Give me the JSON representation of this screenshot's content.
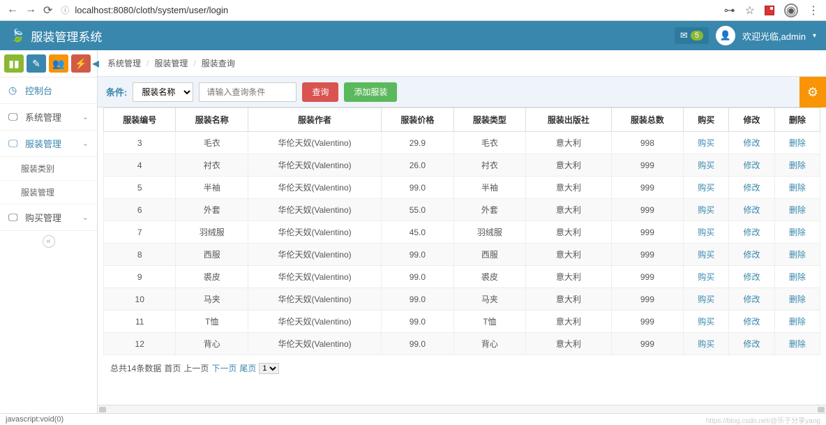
{
  "browser": {
    "url": "localhost:8080/cloth/system/user/login"
  },
  "header": {
    "title": "服装管理系统",
    "mail_badge": "5",
    "welcome": "欢迎光临,admin"
  },
  "sidebar": {
    "items": [
      {
        "label": "控制台",
        "icon": "dashboard"
      },
      {
        "label": "系统管理",
        "icon": "monitor",
        "expandable": true
      },
      {
        "label": "服装管理",
        "icon": "monitor",
        "expandable": true,
        "active": true
      },
      {
        "label": "购买管理",
        "icon": "monitor",
        "expandable": true
      }
    ],
    "sub_items": [
      {
        "label": "服装类别"
      },
      {
        "label": "服装管理"
      }
    ]
  },
  "breadcrumb": {
    "items": [
      "系统管理",
      "服装管理",
      "服装查询"
    ]
  },
  "filter": {
    "label": "条件:",
    "select_value": "服装名称",
    "input_placeholder": "请输入查询条件",
    "search_btn": "查询",
    "add_btn": "添加服装"
  },
  "table": {
    "headers": [
      "服装编号",
      "服装名称",
      "服装作者",
      "服装价格",
      "服装类型",
      "服装出版社",
      "服装总数",
      "购买",
      "修改",
      "删除"
    ],
    "action_buy": "购买",
    "action_edit": "修改",
    "action_delete": "删除",
    "rows": [
      {
        "id": "3",
        "name": "毛衣",
        "author": "华伦天奴(Valentino)",
        "price": "29.9",
        "type": "毛衣",
        "publisher": "意大利",
        "total": "998"
      },
      {
        "id": "4",
        "name": "衬衣",
        "author": "华伦天奴(Valentino)",
        "price": "26.0",
        "type": "衬衣",
        "publisher": "意大利",
        "total": "999"
      },
      {
        "id": "5",
        "name": "半袖",
        "author": "华伦天奴(Valentino)",
        "price": "99.0",
        "type": "半袖",
        "publisher": "意大利",
        "total": "999"
      },
      {
        "id": "6",
        "name": "外套",
        "author": "华伦天奴(Valentino)",
        "price": "55.0",
        "type": "外套",
        "publisher": "意大利",
        "total": "999"
      },
      {
        "id": "7",
        "name": "羽绒服",
        "author": "华伦天奴(Valentino)",
        "price": "45.0",
        "type": "羽绒服",
        "publisher": "意大利",
        "total": "999"
      },
      {
        "id": "8",
        "name": "西服",
        "author": "华伦天奴(Valentino)",
        "price": "99.0",
        "type": "西服",
        "publisher": "意大利",
        "total": "999"
      },
      {
        "id": "9",
        "name": "裘皮",
        "author": "华伦天奴(Valentino)",
        "price": "99.0",
        "type": "裘皮",
        "publisher": "意大利",
        "total": "999"
      },
      {
        "id": "10",
        "name": "马夹",
        "author": "华伦天奴(Valentino)",
        "price": "99.0",
        "type": "马夹",
        "publisher": "意大利",
        "total": "999"
      },
      {
        "id": "11",
        "name": "T恤",
        "author": "华伦天奴(Valentino)",
        "price": "99.0",
        "type": "T恤",
        "publisher": "意大利",
        "total": "999"
      },
      {
        "id": "12",
        "name": "背心",
        "author": "华伦天奴(Valentino)",
        "price": "99.0",
        "type": "背心",
        "publisher": "意大利",
        "total": "999"
      }
    ]
  },
  "pagination": {
    "total_text": "总共14条数据",
    "first": "首页",
    "prev": "上一页",
    "next": "下一页",
    "last": "尾页",
    "page_select": "1"
  },
  "status": {
    "text": "javascript:void(0)",
    "watermark": "https://blog.csdn.net/@乐于分享yang"
  }
}
